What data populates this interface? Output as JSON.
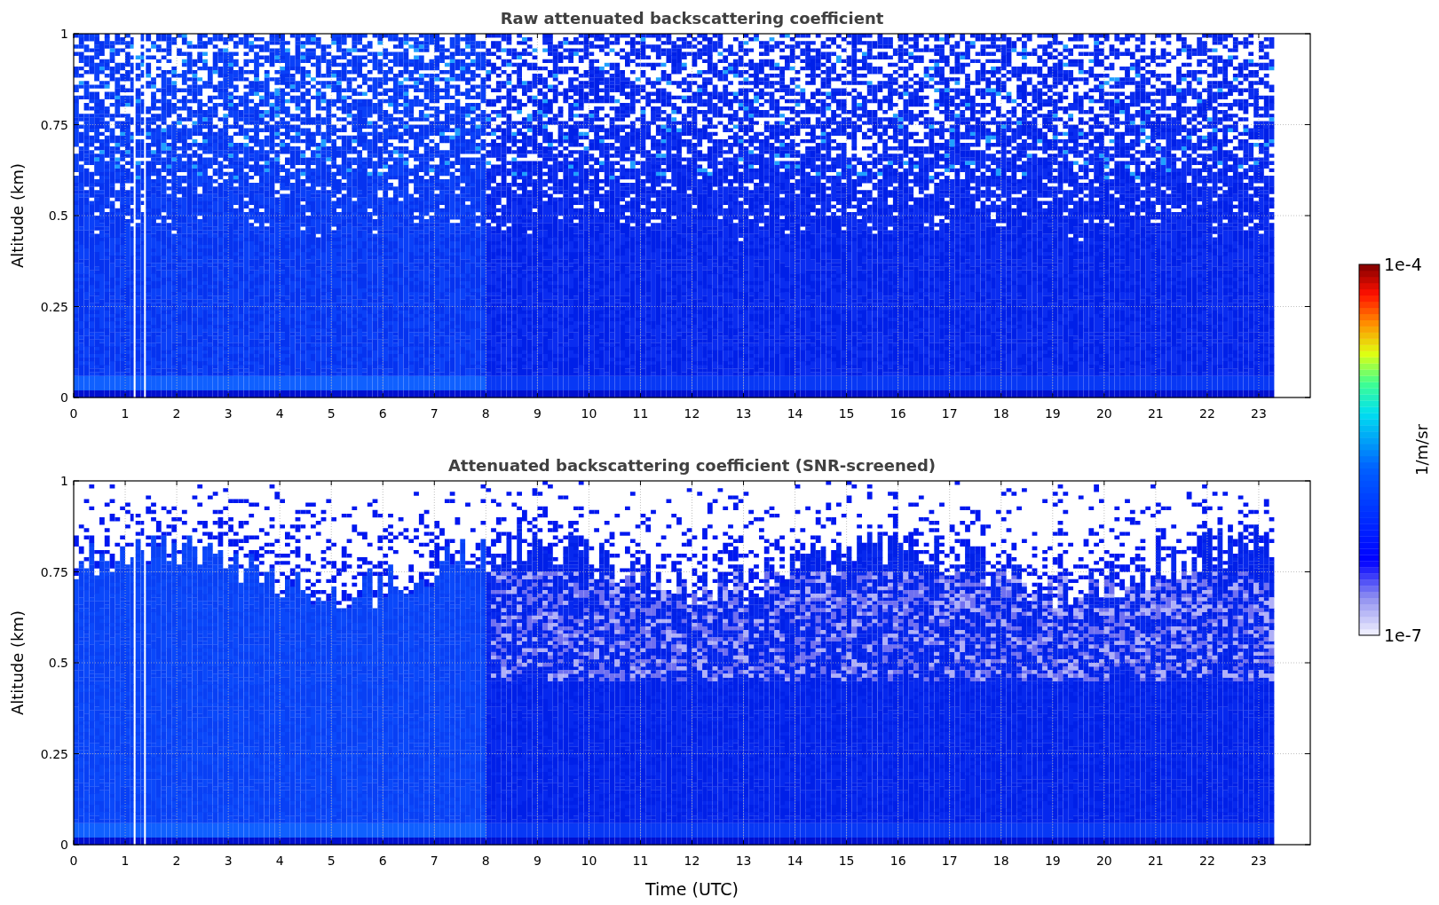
{
  "panels": [
    {
      "kind": "raw",
      "title": "Raw attenuated backscattering coefficient",
      "ylabel": "Altitude (km)",
      "yticks": [
        "1",
        "0.75",
        "0.5",
        "0.25",
        "0"
      ],
      "xticks": [
        "0",
        "1",
        "2",
        "3",
        "4",
        "5",
        "6",
        "7",
        "8",
        "9",
        "10",
        "11",
        "12",
        "13",
        "14",
        "15",
        "16",
        "17",
        "18",
        "19",
        "20",
        "21",
        "22",
        "23"
      ]
    },
    {
      "kind": "screened",
      "title": "Attenuated backscattering coefficient (SNR-screened)",
      "ylabel": "Altitude (km)",
      "xlabel": "Time (UTC)",
      "yticks": [
        "1",
        "0.75",
        "0.5",
        "0.25",
        "0"
      ],
      "xticks": [
        "0",
        "1",
        "2",
        "3",
        "4",
        "5",
        "6",
        "7",
        "8",
        "9",
        "10",
        "11",
        "12",
        "13",
        "14",
        "15",
        "16",
        "17",
        "18",
        "19",
        "20",
        "21",
        "22",
        "23"
      ]
    }
  ],
  "colorbar": {
    "label": "1/m/sr",
    "max": "1e-4",
    "min": "1e-7"
  }
}
